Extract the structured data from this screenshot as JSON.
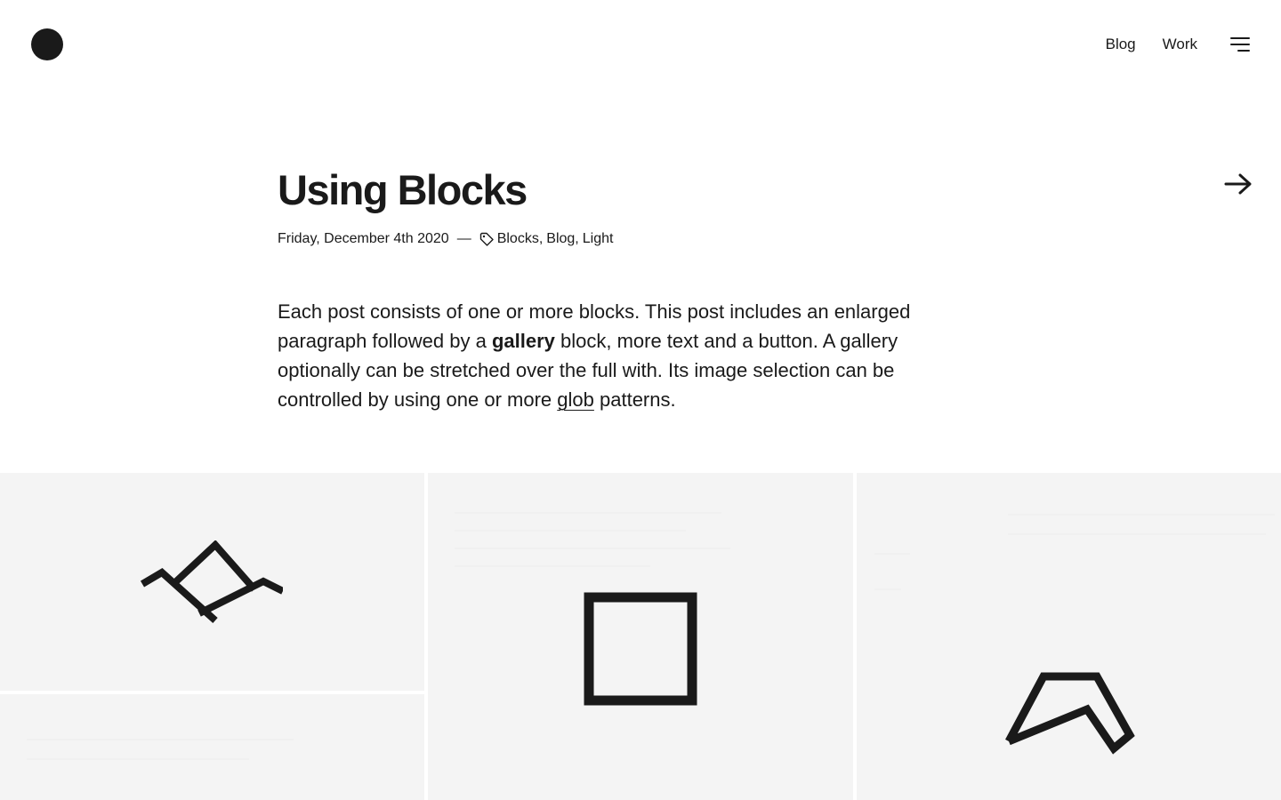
{
  "header": {
    "nav": [
      {
        "label": "Blog"
      },
      {
        "label": "Work"
      }
    ]
  },
  "post": {
    "title": "Using Blocks",
    "date": "Friday, December 4th 2020",
    "meta_separator": "—",
    "tags": [
      "Blocks",
      "Blog",
      "Light"
    ],
    "lead": {
      "part1": "Each post consists of one or more blocks. This post includes an enlarged paragraph followed by a ",
      "bold": "gallery",
      "part2": " block, more text and a button. A gallery optionally can be stretched over the full with. Its image selection can be controlled by using one or more ",
      "link": "glob",
      "part3": " patterns."
    }
  },
  "gallery": {
    "images": [
      {
        "icon": "mountain-logo-icon"
      },
      {
        "icon": "square-logo-icon"
      },
      {
        "icon": "wedge-logo-icon"
      },
      {
        "icon": "blank-image"
      }
    ]
  },
  "colors": {
    "text": "#1a1a1a",
    "background": "#ffffff",
    "tile": "#f4f4f4"
  }
}
